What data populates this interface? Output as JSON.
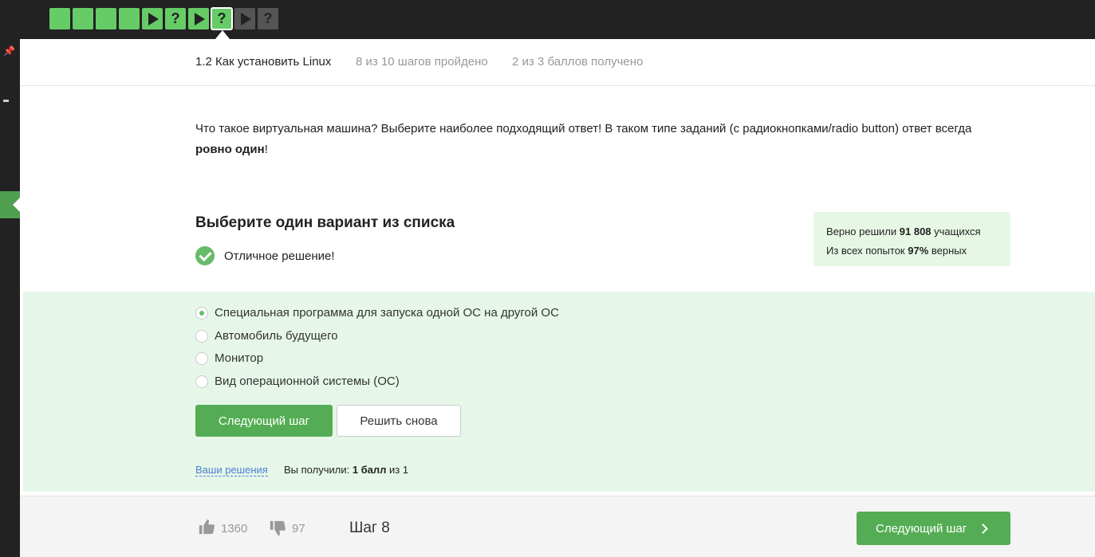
{
  "steps": [
    {
      "state": "done",
      "type": "text",
      "label": ""
    },
    {
      "state": "done",
      "type": "text",
      "label": ""
    },
    {
      "state": "done",
      "type": "text",
      "label": ""
    },
    {
      "state": "done",
      "type": "text",
      "label": ""
    },
    {
      "state": "done",
      "type": "video",
      "label": ""
    },
    {
      "state": "done",
      "type": "quiz",
      "label": "?"
    },
    {
      "state": "done",
      "type": "video",
      "label": ""
    },
    {
      "state": "current",
      "type": "quiz",
      "label": "?"
    },
    {
      "state": "todo",
      "type": "video",
      "label": ""
    },
    {
      "state": "todo",
      "type": "quiz",
      "label": "?"
    }
  ],
  "header": {
    "title": "1.2 Как установить Linux",
    "progress": "8 из 10 шагов пройдено",
    "score": "2 из 3 баллов  получено"
  },
  "question": {
    "text_before": "Что такое виртуальная машина? Выберите наиболее подходящий ответ! В таком типе заданий (с радиокнопками/radio button) ответ всегда ",
    "text_bold": "ровно один",
    "text_after": "!"
  },
  "choose_title": "Выберите один вариант из списка",
  "feedback": "Отличное решение!",
  "stats": {
    "line1_prefix": "Верно решили ",
    "line1_value": "91 808",
    "line1_suffix": " учащихся",
    "line2_prefix": "Из всех попыток ",
    "line2_value": "97%",
    "line2_suffix": " верных"
  },
  "options": [
    {
      "label": "Специальная программа для запуска одной ОС на другой ОС",
      "checked": true
    },
    {
      "label": "Автомобиль будущего",
      "checked": false
    },
    {
      "label": "Монитор",
      "checked": false
    },
    {
      "label": "Вид операционной системы (ОС)",
      "checked": false
    }
  ],
  "buttons": {
    "next": "Следующий шаг",
    "retry": "Решить снова"
  },
  "solutions_link": "Ваши решения",
  "received": {
    "prefix": "Вы получили: ",
    "value": "1 балл",
    "suffix": " из 1"
  },
  "footer": {
    "likes": "1360",
    "dislikes": "97",
    "step_label": "Шаг 8",
    "next_label": "Следующий шаг"
  },
  "colors": {
    "accent": "#54ad54",
    "done_step": "#66cc66",
    "answers_bg": "#e6f7e9"
  }
}
